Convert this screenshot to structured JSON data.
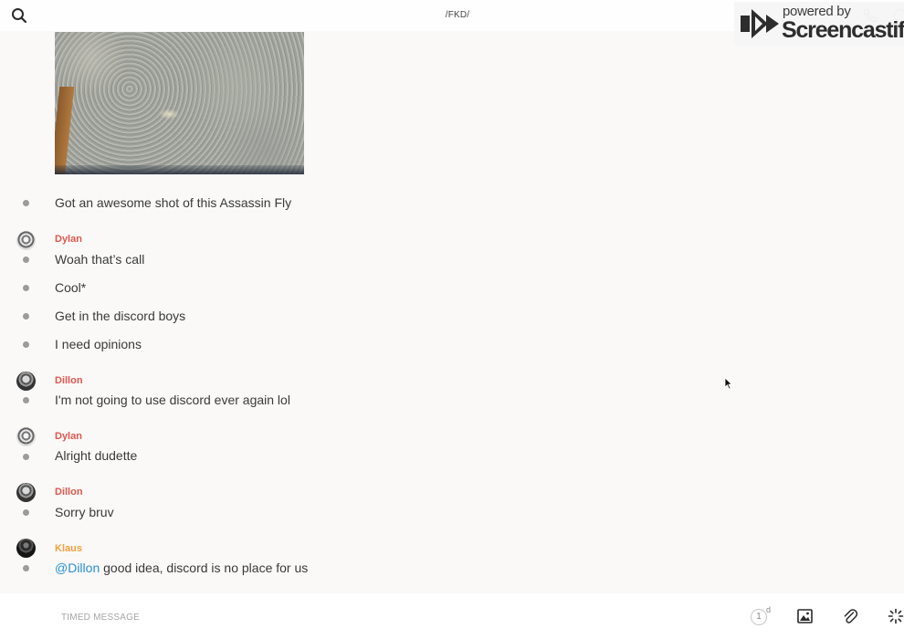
{
  "header": {
    "channel_title": "/FKD/",
    "icons": {
      "search": "search-icon",
      "call": "phone-icon",
      "info": "info-icon"
    }
  },
  "watermark": {
    "powered_by": "powered by",
    "brand": "Screencastify"
  },
  "messages": [
    {
      "type": "image",
      "description_icon": "photo-attachment"
    },
    {
      "author": "",
      "text": "Got an awesome shot of this Assassin Fly"
    },
    {
      "author": "Dylan",
      "author_color": "#e0574f",
      "text": "Woah that’s call"
    },
    {
      "author": "",
      "text": "Cool*"
    },
    {
      "author": "",
      "text": "Get in the discord boys"
    },
    {
      "author": "",
      "text": "I need opinions"
    },
    {
      "author": "Dillon",
      "author_color": "#e0574f",
      "text": "I'm not going to use discord ever again lol"
    },
    {
      "author": "Dylan",
      "author_color": "#e0574f",
      "text": "Alright dudette"
    },
    {
      "author": "Dillon",
      "author_color": "#e0574f",
      "text": "Sorry bruv"
    },
    {
      "author": "Klaus",
      "author_color": "#f0a03c",
      "mention": "@Dillon",
      "text": " good idea, discord is no place for us"
    }
  ],
  "composer": {
    "placeholder": "TIMED MESSAGE",
    "timer_value": "1",
    "timer_unit": "d",
    "icons": {
      "timer": "timer-icon",
      "image": "image-icon",
      "attach": "paperclip-icon",
      "effects": "sparkle-icon"
    }
  },
  "colors": {
    "background": "#faf9f8",
    "author_red": "#e0574f",
    "author_orange": "#f0a03c",
    "mention_blue": "#2a8fd6",
    "bullet_gray": "#9b9b9b"
  }
}
